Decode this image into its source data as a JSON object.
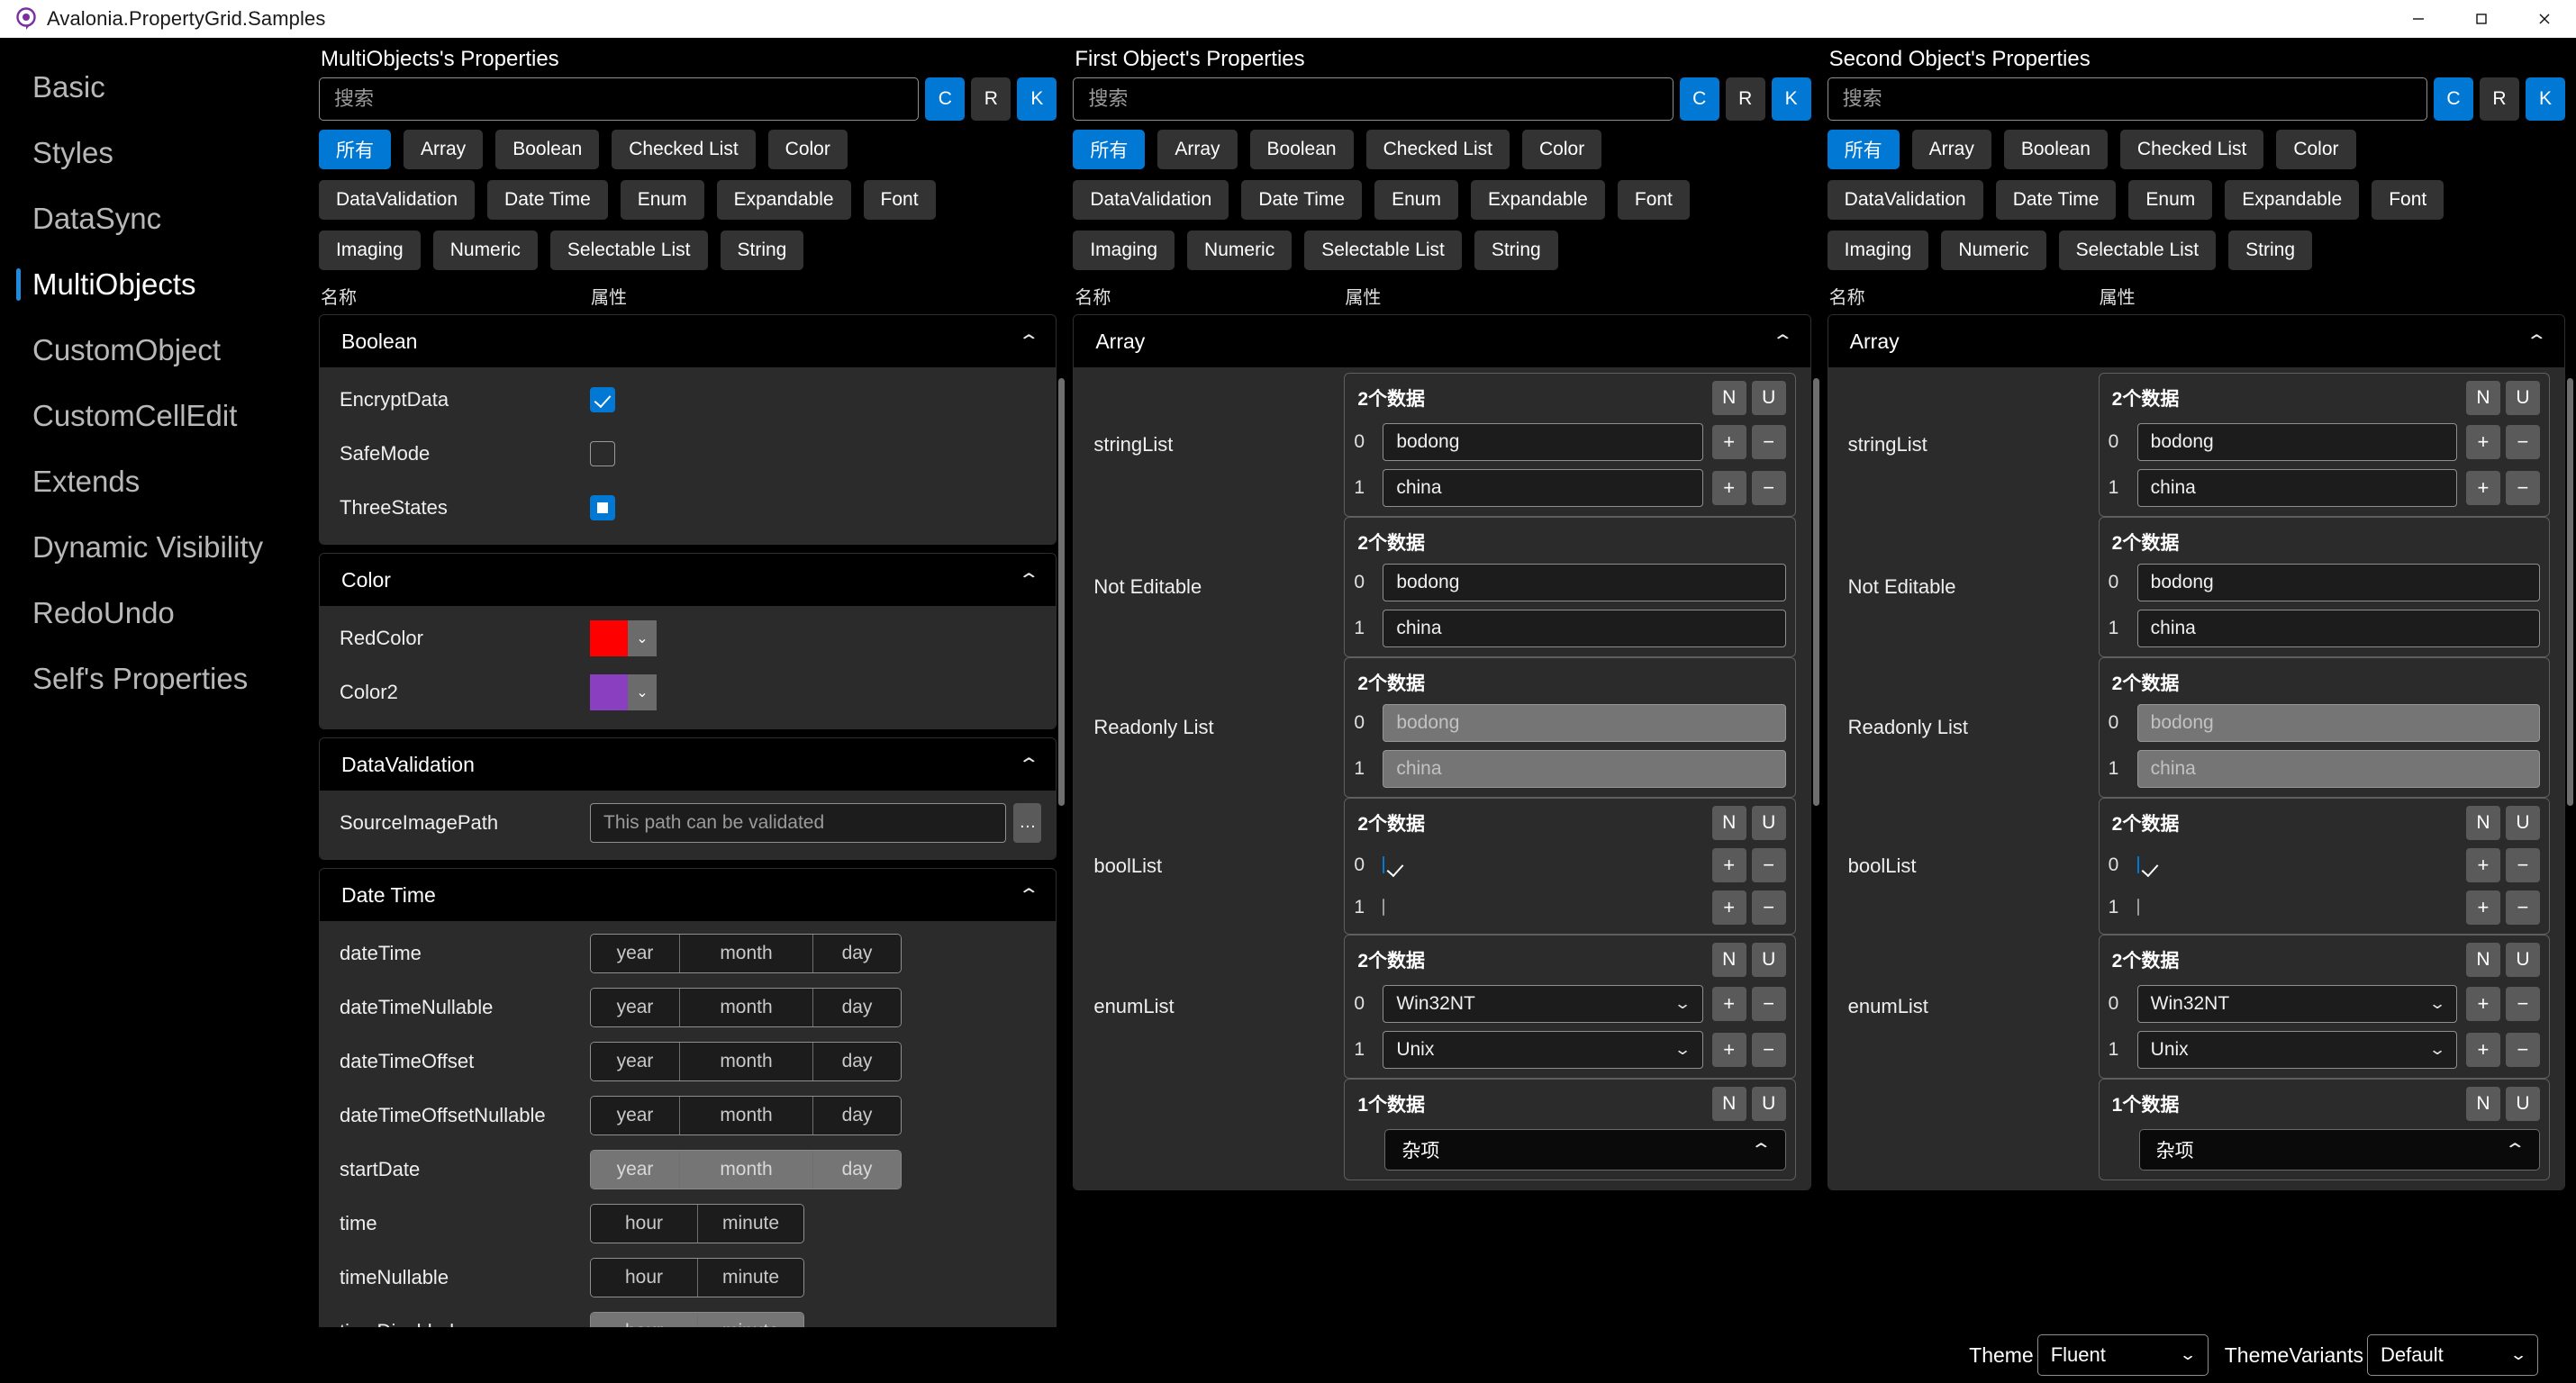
{
  "window": {
    "title": "Avalonia.PropertyGrid.Samples",
    "app_icon": "avalonia-logo-icon",
    "minimize_label": "—",
    "maximize_label": "▢",
    "close_label": "✕"
  },
  "sidebar": {
    "items": [
      {
        "label": "Basic",
        "active": false
      },
      {
        "label": "Styles",
        "active": false
      },
      {
        "label": "DataSync",
        "active": false
      },
      {
        "label": "MultiObjects",
        "active": true
      },
      {
        "label": "CustomObject",
        "active": false
      },
      {
        "label": "CustomCellEdit",
        "active": false
      },
      {
        "label": "Extends",
        "active": false
      },
      {
        "label": "Dynamic Visibility",
        "active": false
      },
      {
        "label": "RedoUndo",
        "active": false
      },
      {
        "label": "Self's Properties",
        "active": false
      }
    ]
  },
  "common": {
    "search_placeholder": "搜索",
    "toggle_c": "C",
    "toggle_r": "R",
    "toggle_k": "K",
    "col_name": "名称",
    "col_property": "属性",
    "filters_row1": [
      "所有",
      "Array",
      "Boolean",
      "Checked List",
      "Color"
    ],
    "filters_row2": [
      "DataValidation",
      "Date Time",
      "Enum",
      "Expandable",
      "Font"
    ],
    "filters_row3": [
      "Imaging",
      "Numeric",
      "Selectable List",
      "String"
    ],
    "active_filter": "所有",
    "chev_up": "⌃",
    "chev_down": "⌄",
    "btn_new": "N",
    "btn_up": "U",
    "btn_add": "+",
    "btn_remove": "−",
    "btn_ellipsis": "…"
  },
  "panels": [
    {
      "title": "MultiObjects's Properties",
      "toggles": {
        "c": true,
        "r": false,
        "k": true
      },
      "categories": [
        {
          "name": "Boolean",
          "expanded": true,
          "rows": [
            {
              "type": "checkbox",
              "name": "EncryptData",
              "state": "checked"
            },
            {
              "type": "checkbox",
              "name": "SafeMode",
              "state": "unchecked"
            },
            {
              "type": "checkbox",
              "name": "ThreeStates",
              "state": "indeterminate"
            }
          ]
        },
        {
          "name": "Color",
          "expanded": true,
          "rows": [
            {
              "type": "color",
              "name": "RedColor",
              "value": "#ff0000"
            },
            {
              "type": "color",
              "name": "Color2",
              "value": "#8a3fc0"
            }
          ]
        },
        {
          "name": "DataValidation",
          "expanded": true,
          "rows": [
            {
              "type": "path",
              "name": "SourceImagePath",
              "placeholder": "This path can be validated",
              "value": ""
            }
          ]
        },
        {
          "name": "Date Time",
          "expanded": true,
          "rows": [
            {
              "type": "date",
              "name": "dateTime",
              "year": "year",
              "month": "month",
              "day": "day",
              "disabled": false
            },
            {
              "type": "date",
              "name": "dateTimeNullable",
              "year": "year",
              "month": "month",
              "day": "day",
              "disabled": false
            },
            {
              "type": "date",
              "name": "dateTimeOffset",
              "year": "year",
              "month": "month",
              "day": "day",
              "disabled": false
            },
            {
              "type": "date",
              "name": "dateTimeOffsetNullable",
              "year": "year",
              "month": "month",
              "day": "day",
              "disabled": false
            },
            {
              "type": "date",
              "name": "startDate",
              "year": "year",
              "month": "month",
              "day": "day",
              "disabled": true
            },
            {
              "type": "time",
              "name": "time",
              "hour": "hour",
              "minute": "minute",
              "disabled": false
            },
            {
              "type": "time",
              "name": "timeNullable",
              "hour": "hour",
              "minute": "minute",
              "disabled": false
            },
            {
              "type": "time",
              "name": "timeDisabled",
              "hour": "hour",
              "minute": "minute",
              "disabled": true
            }
          ]
        }
      ]
    },
    {
      "title": "First Object's Properties",
      "toggles": {
        "c": true,
        "r": false,
        "k": true
      },
      "categories": [
        {
          "name": "Array",
          "expanded": true,
          "rows": [
            {
              "type": "list",
              "name": "stringList",
              "count_label": "2个数据",
              "show_nu": true,
              "show_pm": true,
              "readonly": false,
              "items": [
                {
                  "index": "0",
                  "value": "bodong",
                  "kind": "text"
                },
                {
                  "index": "1",
                  "value": "china",
                  "kind": "text"
                }
              ]
            },
            {
              "type": "list",
              "name": "Not Editable",
              "count_label": "2个数据",
              "show_nu": false,
              "show_pm": false,
              "readonly": false,
              "items": [
                {
                  "index": "0",
                  "value": "bodong",
                  "kind": "text"
                },
                {
                  "index": "1",
                  "value": "china",
                  "kind": "text"
                }
              ]
            },
            {
              "type": "list",
              "name": "Readonly List",
              "count_label": "2个数据",
              "show_nu": false,
              "show_pm": false,
              "readonly": true,
              "items": [
                {
                  "index": "0",
                  "value": "bodong",
                  "kind": "text"
                },
                {
                  "index": "1",
                  "value": "china",
                  "kind": "text"
                }
              ]
            },
            {
              "type": "list",
              "name": "boolList",
              "count_label": "2个数据",
              "show_nu": true,
              "show_pm": true,
              "readonly": false,
              "items": [
                {
                  "index": "0",
                  "value": "",
                  "kind": "checkbox",
                  "state": "checked"
                },
                {
                  "index": "1",
                  "value": "",
                  "kind": "checkbox",
                  "state": "unchecked"
                }
              ]
            },
            {
              "type": "list",
              "name": "enumList",
              "count_label": "2个数据",
              "show_nu": true,
              "show_pm": true,
              "readonly": false,
              "items": [
                {
                  "index": "0",
                  "value": "Win32NT",
                  "kind": "select"
                },
                {
                  "index": "1",
                  "value": "Unix",
                  "kind": "select"
                }
              ]
            },
            {
              "type": "list",
              "name": "",
              "count_label": "1个数据",
              "show_nu": true,
              "show_pm": false,
              "readonly": false,
              "items": [
                {
                  "index": "",
                  "value": "杂项",
                  "kind": "expander"
                }
              ]
            }
          ]
        }
      ]
    },
    {
      "title": "Second Object's Properties",
      "toggles": {
        "c": true,
        "r": false,
        "k": true
      },
      "categories": [
        {
          "name": "Array",
          "expanded": true,
          "rows": [
            {
              "type": "list",
              "name": "stringList",
              "count_label": "2个数据",
              "show_nu": true,
              "show_pm": true,
              "readonly": false,
              "items": [
                {
                  "index": "0",
                  "value": "bodong",
                  "kind": "text"
                },
                {
                  "index": "1",
                  "value": "china",
                  "kind": "text"
                }
              ]
            },
            {
              "type": "list",
              "name": "Not Editable",
              "count_label": "2个数据",
              "show_nu": false,
              "show_pm": false,
              "readonly": false,
              "items": [
                {
                  "index": "0",
                  "value": "bodong",
                  "kind": "text"
                },
                {
                  "index": "1",
                  "value": "china",
                  "kind": "text"
                }
              ]
            },
            {
              "type": "list",
              "name": "Readonly List",
              "count_label": "2个数据",
              "show_nu": false,
              "show_pm": false,
              "readonly": true,
              "items": [
                {
                  "index": "0",
                  "value": "bodong",
                  "kind": "text"
                },
                {
                  "index": "1",
                  "value": "china",
                  "kind": "text"
                }
              ]
            },
            {
              "type": "list",
              "name": "boolList",
              "count_label": "2个数据",
              "show_nu": true,
              "show_pm": true,
              "readonly": false,
              "items": [
                {
                  "index": "0",
                  "value": "",
                  "kind": "checkbox",
                  "state": "checked"
                },
                {
                  "index": "1",
                  "value": "",
                  "kind": "checkbox",
                  "state": "unchecked"
                }
              ]
            },
            {
              "type": "list",
              "name": "enumList",
              "count_label": "2个数据",
              "show_nu": true,
              "show_pm": true,
              "readonly": false,
              "items": [
                {
                  "index": "0",
                  "value": "Win32NT",
                  "kind": "select"
                },
                {
                  "index": "1",
                  "value": "Unix",
                  "kind": "select"
                }
              ]
            },
            {
              "type": "list",
              "name": "",
              "count_label": "1个数据",
              "show_nu": true,
              "show_pm": false,
              "readonly": false,
              "items": [
                {
                  "index": "",
                  "value": "杂项",
                  "kind": "expander"
                }
              ]
            }
          ]
        }
      ]
    }
  ],
  "bottombar": {
    "theme_label": "Theme",
    "theme_value": "Fluent",
    "variants_label": "ThemeVariants",
    "variants_value": "Default"
  },
  "colors": {
    "accent": "#0078d4",
    "panel_bg": "#000000",
    "card_bg": "#2b2b2b",
    "chip_bg": "#333333"
  }
}
